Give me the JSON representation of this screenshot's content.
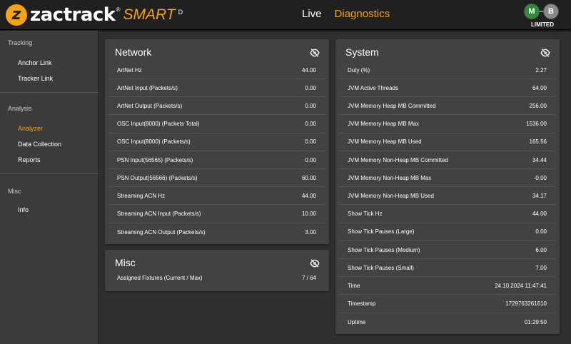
{
  "header": {
    "logo_mark": "z",
    "logo_text": "zactrack",
    "logo_reg": "®",
    "logo_smart": "SMART",
    "logo_edition": "D",
    "nav_live": "Live",
    "nav_diagnostics": "Diagnostics",
    "badge_m": "M",
    "badge_b": "B",
    "status_label": "LIMITED"
  },
  "sidebar": {
    "tracking": "Tracking",
    "anchor_link": "Anchor Link",
    "tracker_link": "Tracker Link",
    "analysis": "Analysis",
    "analyzer": "Analyzer",
    "data_collection": "Data Collection",
    "reports": "Reports",
    "misc": "Misc",
    "info": "Info"
  },
  "network": {
    "title": "Network",
    "rows": [
      {
        "label": "ArtNet Hz",
        "value": "44.00"
      },
      {
        "label": "ArtNet Input (Packets/s)",
        "value": "0.00"
      },
      {
        "label": "ArtNet Output (Packets/s)",
        "value": "0.00"
      },
      {
        "label": "OSC Input(8000) (Packets Total)",
        "value": "0.00"
      },
      {
        "label": "OSC Input(8000) (Packets/s)",
        "value": "0.00"
      },
      {
        "label": "PSN Input(56565) (Packets/s)",
        "value": "0.00"
      },
      {
        "label": "PSN Output(56566) (Packets/s)",
        "value": "60.00"
      },
      {
        "label": "Streaming ACN Hz",
        "value": "44.00"
      },
      {
        "label": "Streaming ACN Input (Packets/s)",
        "value": "10.00"
      },
      {
        "label": "Streaming ACN Output (Packets/s)",
        "value": "3.00"
      }
    ]
  },
  "misc": {
    "title": "Misc",
    "rows": [
      {
        "label": "Assigned Fixtures (Current / Max)",
        "value": "7 / 64"
      }
    ]
  },
  "system": {
    "title": "System",
    "rows": [
      {
        "label": "Duty (%)",
        "value": "2.27"
      },
      {
        "label": "JVM Active Threads",
        "value": "64.00"
      },
      {
        "label": "JVM Memory Heap MB Committed",
        "value": "256.00"
      },
      {
        "label": "JVM Memory Heap MB Max",
        "value": "1536.00"
      },
      {
        "label": "JVM Memory Heap MB Used",
        "value": "165.56"
      },
      {
        "label": "JVM Memory Non-Heap MB Committed",
        "value": "34.44"
      },
      {
        "label": "JVM Memory Non-Heap MB Max",
        "value": "-0.00"
      },
      {
        "label": "JVM Memory Non-Heap MB Used",
        "value": "34.17"
      },
      {
        "label": "Show Tick Hz",
        "value": "44.00"
      },
      {
        "label": "Show Tick Pauses (Large)",
        "value": "0.00"
      },
      {
        "label": "Show Tick Pauses (Medium)",
        "value": "6.00"
      },
      {
        "label": "Show Tick Pauses (Small)",
        "value": "7.00"
      },
      {
        "label": "Time",
        "value": "24.10.2024 11:47:41"
      },
      {
        "label": "Timestamp",
        "value": "1729763261610"
      },
      {
        "label": "Uptime",
        "value": "01:29:50"
      }
    ]
  },
  "icons": {
    "visibility": "eye-off-icon"
  },
  "colors": {
    "accent": "#f5a313",
    "status_green": "#2e8b3a"
  }
}
